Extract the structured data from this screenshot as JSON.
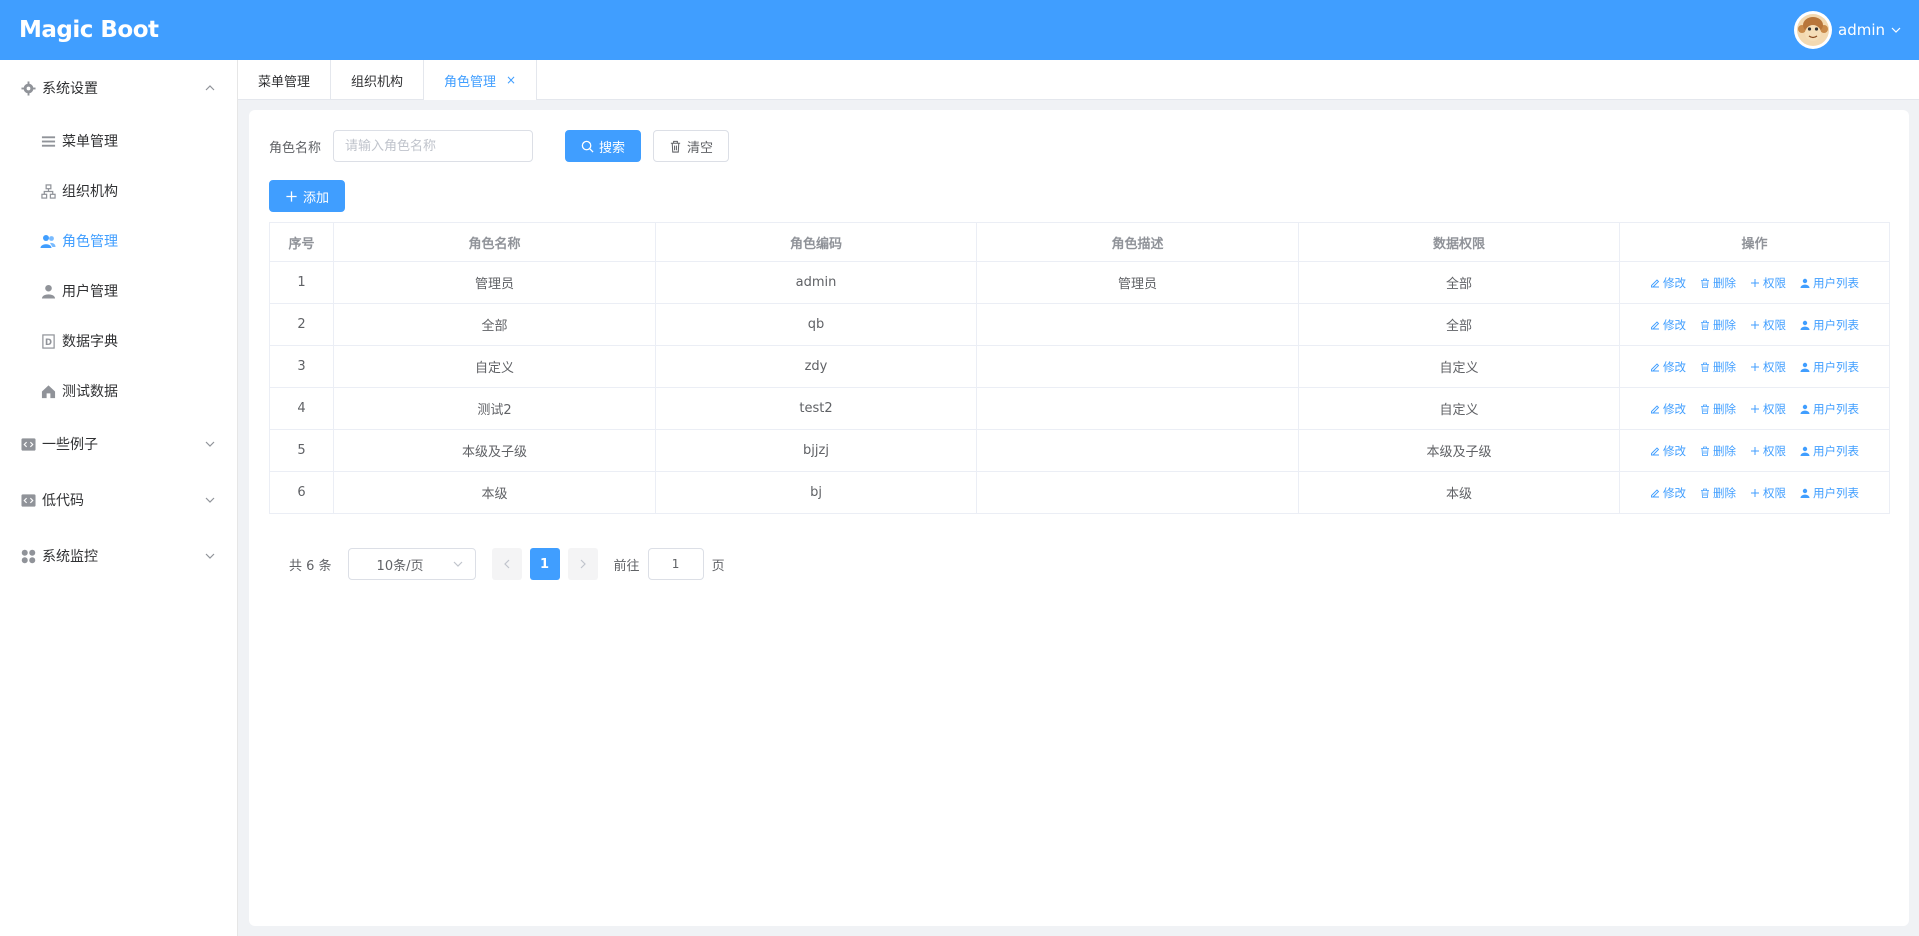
{
  "header": {
    "logo": "Magic Boot",
    "username": "admin",
    "brand_color": "#409eff"
  },
  "sidebar": {
    "groups": [
      {
        "label": "系统设置",
        "icon": "gear-icon",
        "expanded": true,
        "items": [
          {
            "label": "菜单管理",
            "icon": "menu-icon",
            "active": false
          },
          {
            "label": "组织机构",
            "icon": "org-icon",
            "active": false
          },
          {
            "label": "角色管理",
            "icon": "users-icon",
            "active": true
          },
          {
            "label": "用户管理",
            "icon": "user-icon",
            "active": false
          },
          {
            "label": "数据字典",
            "icon": "dict-icon",
            "active": false
          },
          {
            "label": "测试数据",
            "icon": "home-icon",
            "active": false
          }
        ]
      },
      {
        "label": "一些例子",
        "icon": "code-icon",
        "expanded": false
      },
      {
        "label": "低代码",
        "icon": "code-icon",
        "expanded": false
      },
      {
        "label": "系统监控",
        "icon": "grid-icon",
        "expanded": false
      }
    ]
  },
  "tabs": [
    {
      "label": "菜单管理",
      "active": false
    },
    {
      "label": "组织机构",
      "active": false
    },
    {
      "label": "角色管理",
      "active": true,
      "close": "×"
    }
  ],
  "search": {
    "label": "角色名称",
    "placeholder": "请输入角色名称",
    "value": "",
    "search_button": "搜索",
    "clear_button": "清空",
    "add_button": "添加"
  },
  "table": {
    "columns": [
      "序号",
      "角色名称",
      "角色编码",
      "角色描述",
      "数据权限",
      "操作"
    ],
    "actions": [
      "修改",
      "删除",
      "权限",
      "用户列表"
    ],
    "rows": [
      {
        "no": "1",
        "name": "管理员",
        "code": "admin",
        "desc": "管理员",
        "scope": "全部"
      },
      {
        "no": "2",
        "name": "全部",
        "code": "qb",
        "desc": "",
        "scope": "全部"
      },
      {
        "no": "3",
        "name": "自定义",
        "code": "zdy",
        "desc": "",
        "scope": "自定义"
      },
      {
        "no": "4",
        "name": "测试2",
        "code": "test2",
        "desc": "",
        "scope": "自定义"
      },
      {
        "no": "5",
        "name": "本级及子级",
        "code": "bjjzj",
        "desc": "",
        "scope": "本级及子级"
      },
      {
        "no": "6",
        "name": "本级",
        "code": "bj",
        "desc": "",
        "scope": "本级"
      }
    ]
  },
  "pagination": {
    "total_text": "共 6 条",
    "page_size": "10条/页",
    "current_page": "1",
    "goto_label": "前往",
    "goto_value": "1",
    "page_unit": "页"
  }
}
